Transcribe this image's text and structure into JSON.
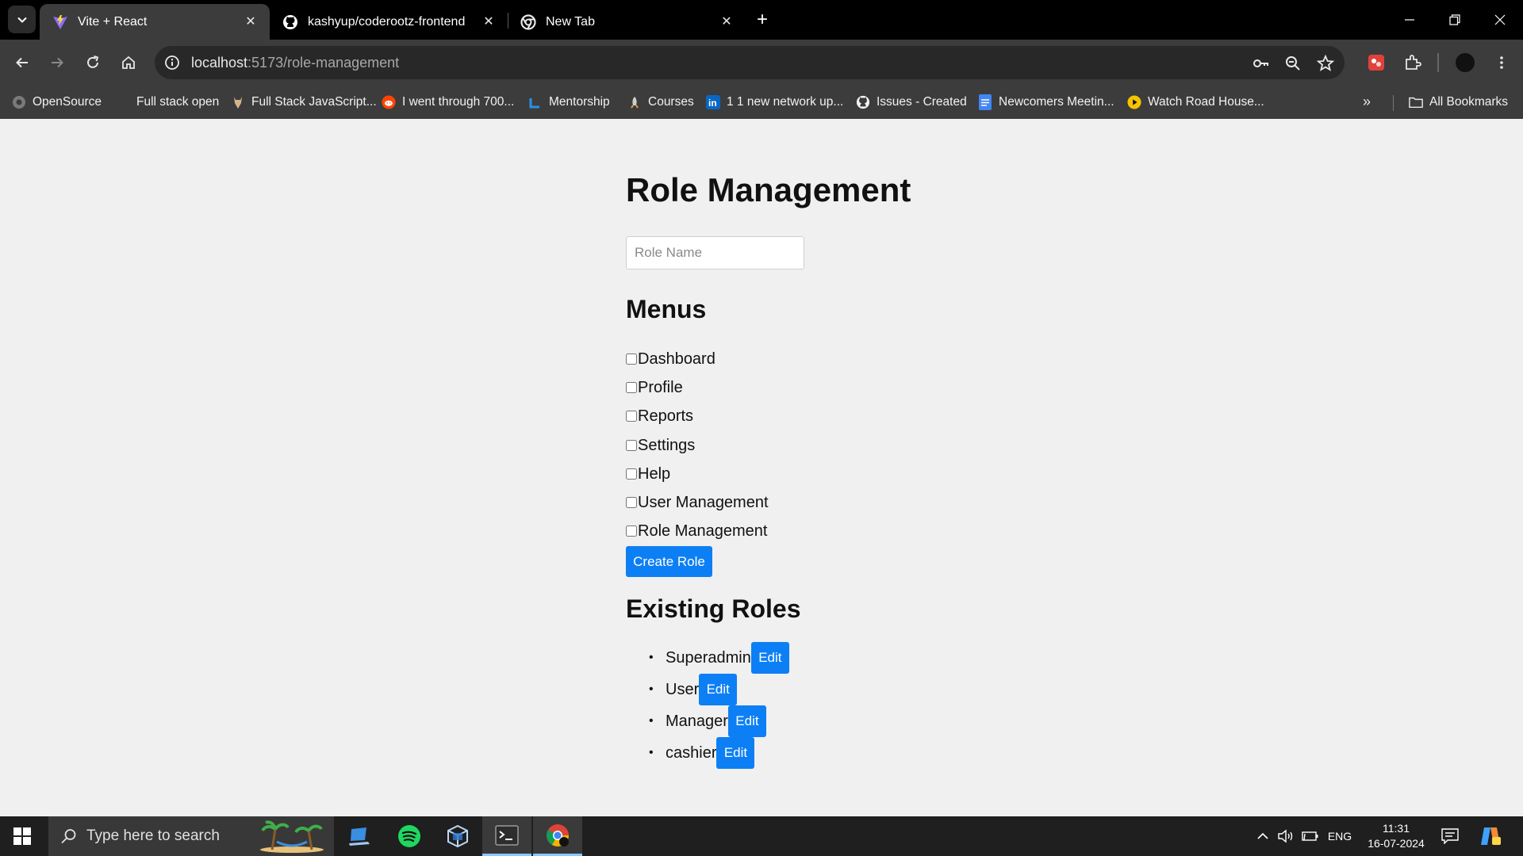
{
  "browser": {
    "tabs": [
      {
        "title": "Vite + React",
        "icon": "vite-icon",
        "active": true
      },
      {
        "title": "kashyup/coderootz-frontend",
        "icon": "github-icon",
        "active": false
      },
      {
        "title": "New Tab",
        "icon": "chrome-icon",
        "active": false
      }
    ],
    "url_host": "localhost",
    "url_path": ":5173/role-management",
    "bookmarks": [
      {
        "label": "OpenSource",
        "icon": "opensource-icon"
      },
      {
        "label": "Full stack open",
        "icon": ""
      },
      {
        "label": "Full Stack JavaScript...",
        "icon": "odin-icon"
      },
      {
        "label": "I went through 700...",
        "icon": "reddit-icon"
      },
      {
        "label": "Mentorship",
        "icon": "mentorship-icon"
      },
      {
        "label": "Courses",
        "icon": "courses-icon"
      },
      {
        "label": "1 1 new network up...",
        "icon": "linkedin-icon"
      },
      {
        "label": "Issues - Created",
        "icon": "github-icon"
      },
      {
        "label": "Newcomers Meetin...",
        "icon": "docs-icon"
      },
      {
        "label": "Watch Road House...",
        "icon": "play-icon"
      }
    ],
    "all_bookmarks": "All Bookmarks"
  },
  "page": {
    "title": "Role Management",
    "role_name_placeholder": "Role Name",
    "menus_title": "Menus",
    "menus": [
      "Dashboard",
      "Profile",
      "Reports",
      "Settings",
      "Help",
      "User Management",
      "Role Management"
    ],
    "create_button": "Create Role",
    "existing_title": "Existing Roles",
    "roles": [
      "Superadmin",
      "User",
      "Manager",
      "cashier"
    ],
    "edit_label": "Edit"
  },
  "taskbar": {
    "search_placeholder": "Type here to search",
    "language": "ENG",
    "time": "11:31",
    "date": "16-07-2024"
  },
  "colors": {
    "accent_button": "#0d7ff5",
    "page_background": "#f0f0f0",
    "chrome_dark": "#3c3c3c"
  }
}
